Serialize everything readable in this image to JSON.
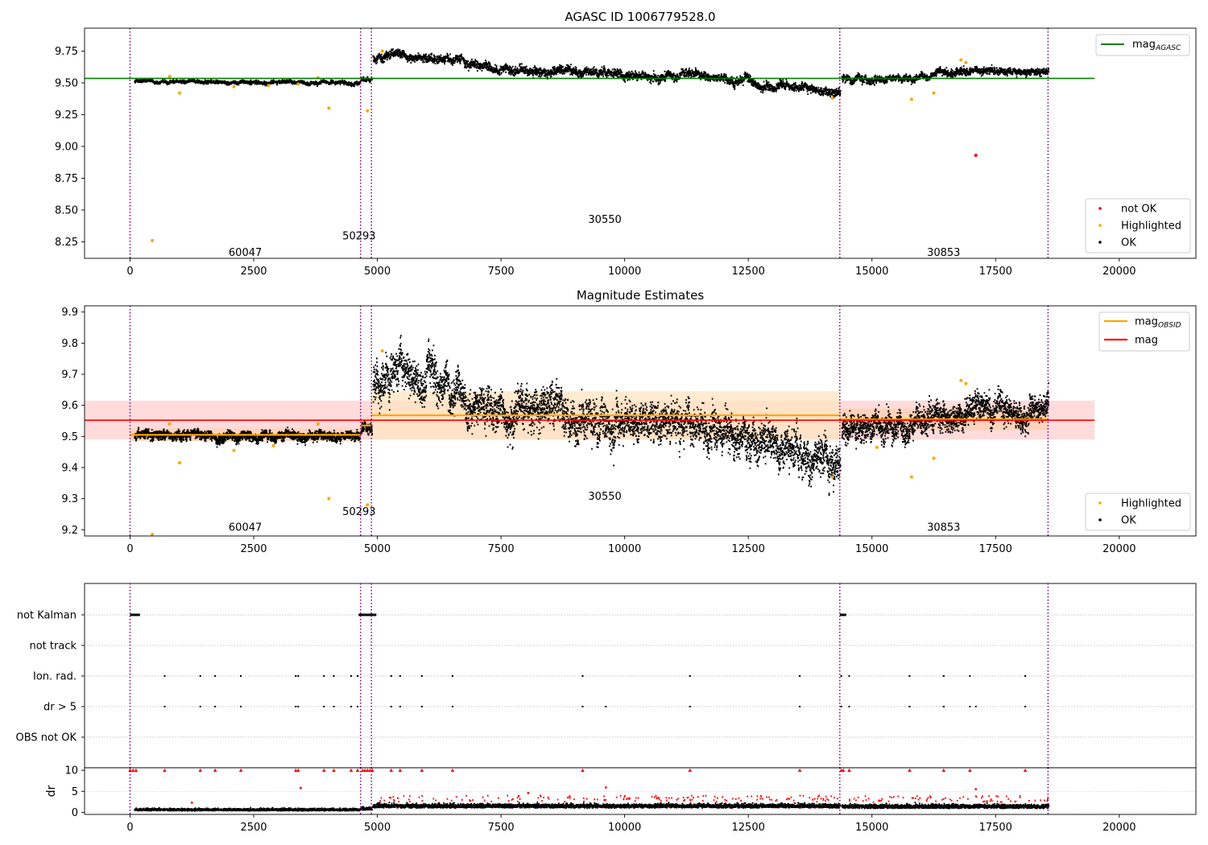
{
  "figure": {
    "x_ticks": [
      0,
      2500,
      5000,
      7500,
      10000,
      12500,
      15000,
      17500,
      20000
    ],
    "xlim": [
      -920,
      21550
    ],
    "obsid_boundaries": [
      0,
      4660,
      4880,
      14350,
      18560
    ],
    "colors": {
      "ok": "#000000",
      "highlighted": "#ffa500",
      "not_ok": "#ff0000",
      "agasc_line": "#008000",
      "obsid_line": "#ffa500",
      "mag_line": "#ff0000",
      "boundary": "#800080",
      "mag_band": "#ffcccc",
      "obsid_band": "#ffe4c0",
      "obsid_band2": "#ffd0b0"
    }
  },
  "chart_data": [
    {
      "type": "scatter",
      "title": "AGASC ID 1006779528.0",
      "ylim": [
        8.12,
        9.93
      ],
      "y_ticks": [
        8.25,
        8.5,
        8.75,
        9.0,
        9.25,
        9.5,
        9.75
      ],
      "legend_location": "top-right + bottom-right",
      "legend_top": [
        {
          "label": "mag",
          "sub": "AGASC",
          "color": "#008000"
        }
      ],
      "legend_bottom": [
        {
          "label": "not OK",
          "color": "#ff0000"
        },
        {
          "label": "Highlighted",
          "color": "#ffa500"
        },
        {
          "label": "OK",
          "color": "#000000"
        }
      ],
      "mag_agasc": 9.535,
      "mag_agasc_x": [
        -920,
        19500
      ],
      "obsid_labels": [
        {
          "text": "60047",
          "x": 2330,
          "y": 8.17
        },
        {
          "text": "50293",
          "x": 4630,
          "y": 8.3
        },
        {
          "text": "30550",
          "x": 9600,
          "y": 8.43
        },
        {
          "text": "30853",
          "x": 16450,
          "y": 8.17
        }
      ],
      "segments": [
        {
          "x": [
            80,
            4640
          ],
          "y_points": [
            [
              80,
              9.51
            ],
            [
              4640,
              9.5
            ]
          ],
          "noise": 0.012
        },
        {
          "x": [
            4660,
            4880
          ],
          "y_points": [
            [
              4660,
              9.53
            ],
            [
              4880,
              9.54
            ]
          ],
          "noise": 0.015
        },
        {
          "x": [
            4900,
            14350
          ],
          "y_points": [
            [
              4900,
              9.7
            ],
            [
              5200,
              9.72
            ],
            [
              6200,
              9.7
            ],
            [
              7000,
              9.66
            ],
            [
              7500,
              9.6
            ],
            [
              8500,
              9.6
            ],
            [
              9200,
              9.58
            ],
            [
              10000,
              9.56
            ],
            [
              11000,
              9.55
            ],
            [
              12000,
              9.52
            ],
            [
              13000,
              9.48
            ],
            [
              13800,
              9.45
            ],
            [
              14200,
              9.42
            ],
            [
              14350,
              9.45
            ]
          ],
          "noise": 0.03
        },
        {
          "x": [
            14380,
            18560
          ],
          "y_points": [
            [
              14380,
              9.53
            ],
            [
              15500,
              9.54
            ],
            [
              16500,
              9.56
            ],
            [
              17200,
              9.59
            ],
            [
              18000,
              9.58
            ],
            [
              18560,
              9.6
            ]
          ],
          "noise": 0.025
        }
      ],
      "highlighted": [
        [
          450,
          8.26
        ],
        [
          1000,
          9.42
        ],
        [
          2100,
          9.47
        ],
        [
          4020,
          9.3
        ],
        [
          4800,
          9.28
        ],
        [
          5100,
          9.75
        ],
        [
          14200,
          9.38
        ],
        [
          15800,
          9.37
        ],
        [
          16250,
          9.42
        ],
        [
          16800,
          9.68
        ],
        [
          16900,
          9.66
        ],
        [
          800,
          9.55
        ],
        [
          3800,
          9.54
        ],
        [
          2800,
          9.48
        ],
        [
          3400,
          9.49
        ]
      ],
      "not_ok": [
        [
          17100,
          8.93
        ]
      ]
    },
    {
      "type": "scatter",
      "title": "Magnitude Estimates",
      "ylim": [
        9.18,
        9.92
      ],
      "y_ticks": [
        9.2,
        9.3,
        9.4,
        9.5,
        9.6,
        9.7,
        9.8,
        9.9
      ],
      "legend_location": "top-right + bottom-right",
      "legend_top": [
        {
          "label": "mag",
          "sub": "OBSID",
          "color": "#ffa500"
        },
        {
          "label": "mag",
          "sub": "",
          "color": "#ff0000"
        }
      ],
      "legend_bottom": [
        {
          "label": "Highlighted",
          "color": "#ffa500"
        },
        {
          "label": "OK",
          "color": "#000000"
        }
      ],
      "mag": 9.552,
      "mag_band": [
        9.49,
        9.615
      ],
      "mag_x": [
        -920,
        19500
      ],
      "obsid_means": [
        {
          "x": [
            0,
            4660
          ],
          "y": 9.505,
          "band": [
            9.485,
            9.525
          ]
        },
        {
          "x": [
            4660,
            4880
          ],
          "y": 9.535,
          "band": [
            9.51,
            9.56
          ]
        },
        {
          "x": [
            4880,
            14350
          ],
          "y": 9.568,
          "band": [
            9.49,
            9.645
          ]
        },
        {
          "x": [
            14350,
            18560
          ],
          "y": 9.555,
          "band": [
            9.52,
            9.59
          ]
        }
      ],
      "obsid_labels": [
        {
          "text": "60047",
          "x": 2330,
          "y": 9.21
        },
        {
          "text": "50293",
          "x": 4630,
          "y": 9.26
        },
        {
          "text": "30550",
          "x": 9600,
          "y": 9.31
        },
        {
          "text": "30853",
          "x": 16450,
          "y": 9.21
        }
      ],
      "segments": [
        {
          "x": [
            80,
            4640
          ],
          "y_points": [
            [
              80,
              9.5
            ],
            [
              4640,
              9.5
            ]
          ],
          "noise": 0.012
        },
        {
          "x": [
            4660,
            4880
          ],
          "y_points": [
            [
              4660,
              9.52
            ],
            [
              4880,
              9.53
            ]
          ],
          "noise": 0.015
        },
        {
          "x": [
            4900,
            14350
          ],
          "y_points": [
            [
              4900,
              9.68
            ],
            [
              5300,
              9.7
            ],
            [
              6100,
              9.7
            ],
            [
              6800,
              9.62
            ],
            [
              7500,
              9.58
            ],
            [
              8500,
              9.58
            ],
            [
              9200,
              9.56
            ],
            [
              10000,
              9.54
            ],
            [
              11000,
              9.53
            ],
            [
              12000,
              9.5
            ],
            [
              13000,
              9.47
            ],
            [
              13800,
              9.44
            ],
            [
              14200,
              9.41
            ],
            [
              14350,
              9.44
            ]
          ],
          "noise": 0.05
        },
        {
          "x": [
            14380,
            18560
          ],
          "y_points": [
            [
              14380,
              9.52
            ],
            [
              15500,
              9.53
            ],
            [
              16500,
              9.55
            ],
            [
              17200,
              9.6
            ],
            [
              18000,
              9.58
            ],
            [
              18560,
              9.6
            ]
          ],
          "noise": 0.035
        }
      ],
      "highlighted": [
        [
          450,
          9.185
        ],
        [
          1000,
          9.415
        ],
        [
          2100,
          9.455
        ],
        [
          4020,
          9.3
        ],
        [
          4800,
          9.28
        ],
        [
          5100,
          9.775
        ],
        [
          14200,
          9.37
        ],
        [
          15800,
          9.37
        ],
        [
          16250,
          9.43
        ],
        [
          16800,
          9.68
        ],
        [
          16900,
          9.67
        ],
        [
          800,
          9.54
        ],
        [
          3800,
          9.54
        ],
        [
          15100,
          9.465
        ],
        [
          2900,
          9.47
        ]
      ]
    },
    {
      "type": "scatter",
      "title": "",
      "categories": [
        "not Kalman",
        "not track",
        "Ion. rad.",
        "dr > 5",
        "OBS not OK"
      ],
      "events": {
        "not Kalman": [
          [
            0,
            200
          ],
          [
            4620,
            4980
          ],
          [
            14350,
            14480
          ]
        ],
        "not track": [],
        "Ion. rad.": [
          700,
          1420,
          1720,
          2240,
          3350,
          3400,
          3920,
          4120,
          4470,
          4600,
          5280,
          5460,
          5900,
          6520,
          9150,
          11320,
          13540,
          14380,
          14540,
          15760,
          16450,
          16980,
          18100
        ],
        "dr > 5": [
          700,
          1420,
          1720,
          2240,
          3350,
          3400,
          3920,
          4120,
          4470,
          4600,
          5280,
          5460,
          5900,
          6520,
          9150,
          9620,
          11320,
          13540,
          14380,
          14540,
          15760,
          16450,
          16980,
          17100,
          18100
        ],
        "OBS not OK": []
      }
    },
    {
      "type": "scatter",
      "title": "",
      "ylabel": "dr",
      "ylim": [
        -0.5,
        10.6
      ],
      "y_ticks": [
        0,
        5,
        10
      ],
      "clip_value": 10,
      "base_segments": [
        {
          "x": [
            80,
            4640
          ],
          "level": 0.5,
          "noise": 0.35
        },
        {
          "x": [
            4660,
            4880
          ],
          "level": 0.7,
          "noise": 0.4
        },
        {
          "x": [
            4900,
            14350
          ],
          "level": 1.3,
          "noise": 0.6
        },
        {
          "x": [
            14380,
            18560
          ],
          "level": 1.2,
          "noise": 0.6
        }
      ],
      "red_clipped": [
        0,
        60,
        120,
        700,
        1420,
        1720,
        2240,
        3350,
        3400,
        3920,
        4120,
        4470,
        4600,
        4700,
        4750,
        4800,
        4850,
        4900,
        5280,
        5460,
        5900,
        6520,
        9150,
        11320,
        13540,
        14380,
        14420,
        14540,
        15760,
        16450,
        16980,
        18100
      ],
      "red_outliers": [
        [
          1250,
          2.3
        ],
        [
          3450,
          5.8
        ],
        [
          8050,
          4.6
        ],
        [
          9620,
          5.9
        ],
        [
          17100,
          5.5
        ]
      ]
    }
  ]
}
